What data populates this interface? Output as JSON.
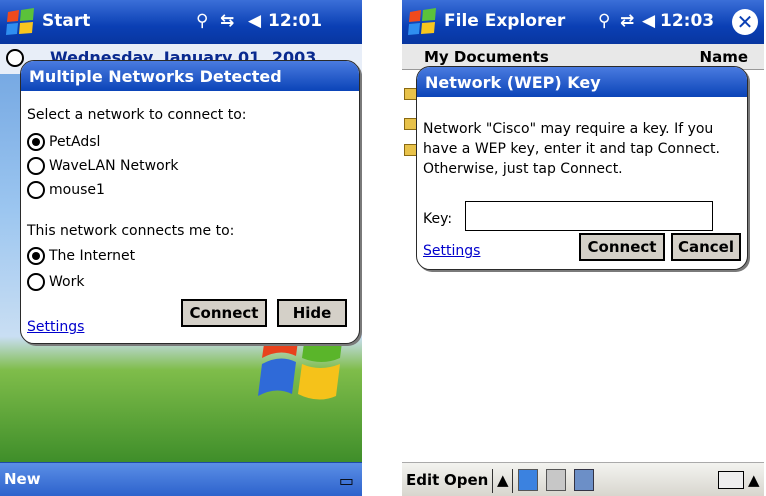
{
  "left": {
    "title": "Start",
    "time": "12:01",
    "today_date": "Wednesday, January 01, 2003",
    "dialog": {
      "title": "Multiple Networks Detected",
      "select_prompt": "Select a network to connect to:",
      "networks": [
        {
          "label": "PetAdsl",
          "selected": true
        },
        {
          "label": "WaveLAN Network",
          "selected": false
        },
        {
          "label": "mouse1",
          "selected": false
        }
      ],
      "connects_prompt": "This network connects me to:",
      "destinations": [
        {
          "label": "The Internet",
          "selected": true
        },
        {
          "label": "Work",
          "selected": false
        }
      ],
      "connect_label": "Connect",
      "hide_label": "Hide",
      "settings_label": "Settings"
    },
    "menu_left": "New",
    "icons": {
      "start": "windows-flag-icon",
      "signal": "antenna-icon",
      "connectivity": "network-arrows-icon",
      "volume": "speaker-icon"
    }
  },
  "right": {
    "title": "File Explorer",
    "time": "12:03",
    "folder": "My Documents",
    "sort": "Name",
    "dialog": {
      "title": "Network (WEP) Key",
      "message": "Network \"Cisco\" may require a key. If you have a WEP key, enter it and tap Connect. Otherwise, just tap Connect.",
      "key_label": "Key:",
      "key_value": "",
      "settings_label": "Settings",
      "connect_label": "Connect",
      "cancel_label": "Cancel"
    },
    "menu": {
      "edit": "Edit",
      "open": "Open"
    },
    "icons": {
      "close": "close-icon",
      "keyboard": "keyboard-icon"
    }
  },
  "colors": {
    "title_bar": "#0a3fb4",
    "link": "#0000cc",
    "button_face": "#d4d0c8"
  }
}
